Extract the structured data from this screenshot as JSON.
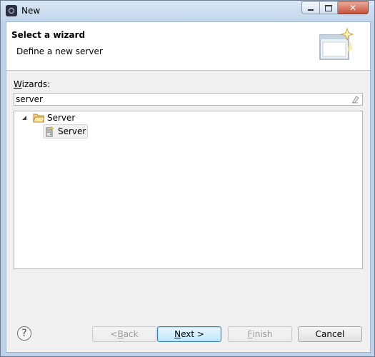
{
  "window": {
    "title": "New",
    "close_glyph": "✕"
  },
  "banner": {
    "title": "Select a wizard",
    "description": "Define a new server",
    "icon": "wizard-banner-icon"
  },
  "wizards": {
    "label_accel": "W",
    "label_rest": "izards:",
    "filter_value": "server"
  },
  "tree": {
    "items": [
      {
        "label": "Server",
        "icon": "folder-icon",
        "expanded": true
      },
      {
        "label": "Server",
        "icon": "server-wizard-icon",
        "selected": true
      }
    ]
  },
  "buttons": {
    "help": "?",
    "back_prefix": "< ",
    "back_accel": "B",
    "back_rest": "ack",
    "next_accel": "N",
    "next_rest": "ext >",
    "finish_accel": "F",
    "finish_rest": "inish",
    "cancel": "Cancel"
  },
  "colors": {
    "frame": "#bcd2ea",
    "default_button": "#bee6fd",
    "close_button": "#c8513a"
  }
}
